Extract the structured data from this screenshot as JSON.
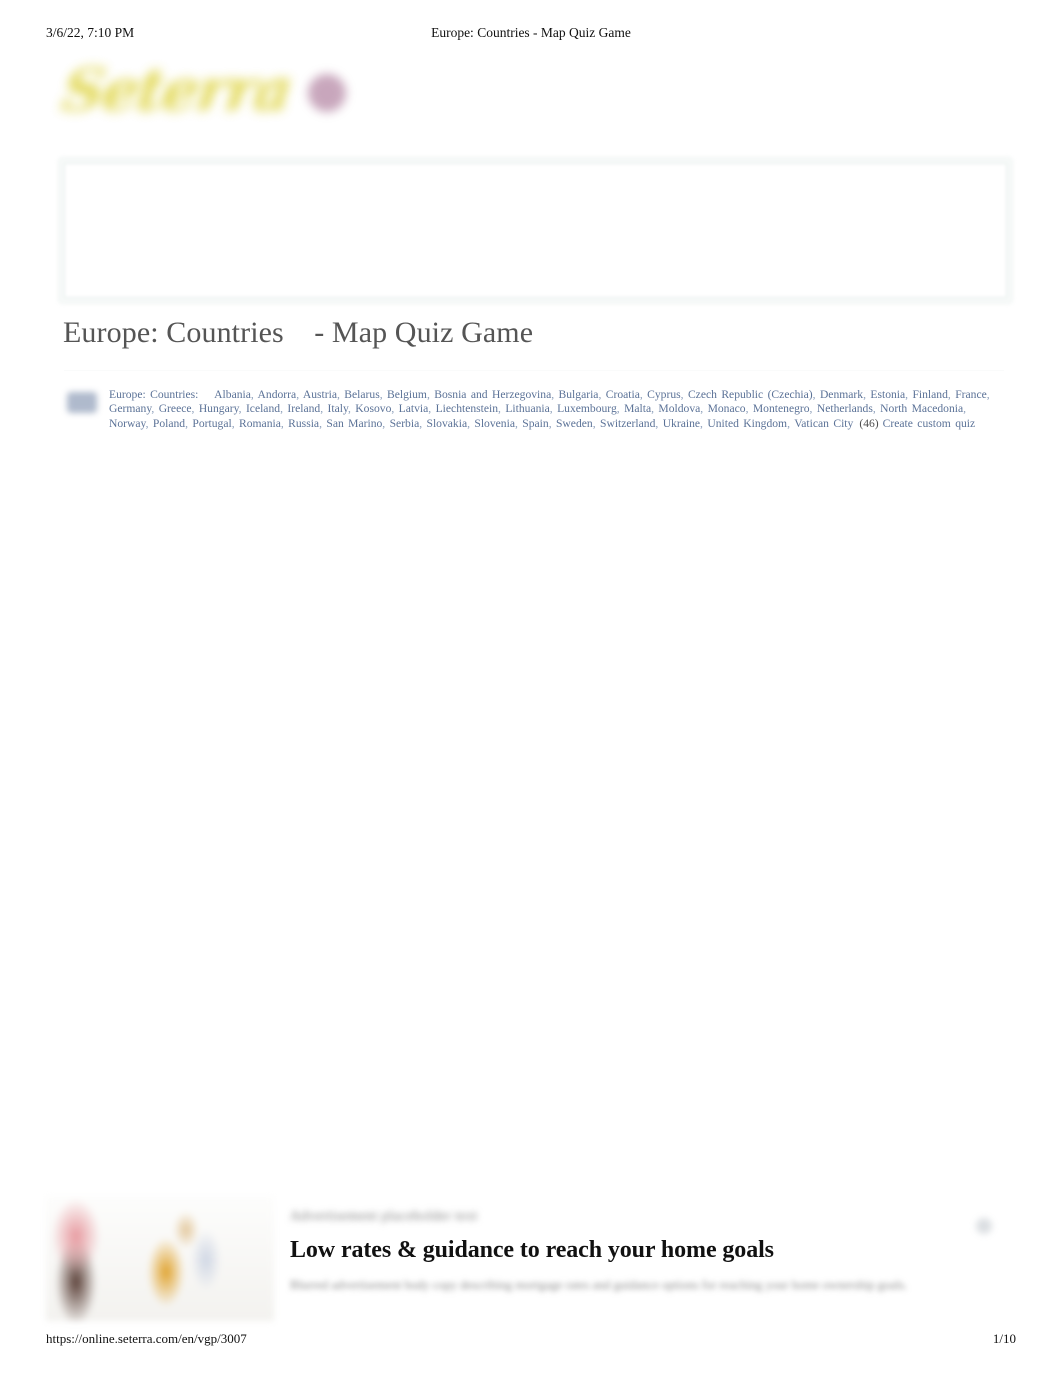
{
  "print": {
    "date": "3/6/22, 7:10 PM",
    "document_title": "Europe: Countries - Map Quiz Game",
    "url": "https://online.seterra.com/en/vgp/3007",
    "page_number": "1/10"
  },
  "site": {
    "logo_text": "Seterra",
    "logo_badge_color": "#9c5f86",
    "logo_color": "#ddd23c"
  },
  "main": {
    "page_title": "Europe: Countries    - Map Quiz Game"
  },
  "country_list": {
    "label": "Europe: Countries:",
    "separator": ",",
    "count": "(46)",
    "custom_quiz_label": "Create custom quiz",
    "link_color": "#5b7297",
    "countries": [
      "Albania",
      "Andorra",
      "Austria",
      "Belarus",
      "Belgium",
      "Bosnia and Herzegovina",
      "Bulgaria",
      "Croatia",
      "Cyprus",
      "Czech Republic (Czechia)",
      "Denmark",
      "Estonia",
      "Finland",
      "France",
      "Germany",
      "Greece",
      "Hungary",
      "Iceland",
      "Ireland",
      "Italy",
      "Kosovo",
      "Latvia",
      "Liechtenstein",
      "Lithuania",
      "Luxembourg",
      "Malta",
      "Moldova",
      "Monaco",
      "Montenegro",
      "Netherlands",
      "North Macedonia",
      "Norway",
      "Poland",
      "Portugal",
      "Romania",
      "Russia",
      "San Marino",
      "Serbia",
      "Slovakia",
      "Slovenia",
      "Spain",
      "Sweden",
      "Switzerland",
      "Ukraine",
      "United Kingdom",
      "Vatican City"
    ]
  },
  "bottom_ad": {
    "eyebrow": "Advertisement placeholder text",
    "headline": "Low rates & guidance to reach your home goals",
    "description": "Blurred advertisement body copy describing mortgage rates and guidance options for reaching your home ownership goals."
  }
}
